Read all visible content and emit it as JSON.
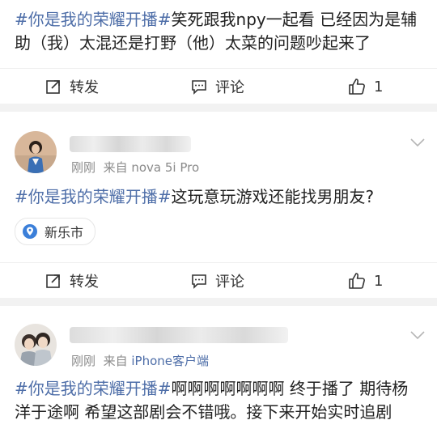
{
  "posts": [
    {
      "hashtag": "#你是我的荣耀开播#",
      "text": "笑死跟我npy一起看 已经因为是辅助（我）太混还是打野（他）太菜的问题吵起来了",
      "actions": {
        "repost": "转发",
        "comment": "评论",
        "like_count": "1"
      }
    },
    {
      "meta_time": "刚刚",
      "meta_from": "来自",
      "meta_source": "nova 5i Pro",
      "hashtag": "#你是我的荣耀开播#",
      "text": "这玩意玩游戏还能找男朋友?",
      "location": "新乐市",
      "actions": {
        "repost": "转发",
        "comment": "评论",
        "like_count": "1"
      }
    },
    {
      "meta_time": "刚刚",
      "meta_from": "来自",
      "meta_source": "iPhone客户端",
      "hashtag": "#你是我的荣耀开播#",
      "text": "啊啊啊啊啊啊啊 终于播了 期待杨洋于途啊 希望这部剧会不错哦。接下来开始实时追剧"
    }
  ],
  "colors": {
    "hashtag": "#4e6ea8",
    "text": "#222222",
    "meta": "#8a8a8a",
    "separator": "#f2f2f2"
  },
  "icons": [
    "repost-icon",
    "comment-icon",
    "like-icon",
    "location-pin-icon",
    "chevron-down-icon"
  ]
}
